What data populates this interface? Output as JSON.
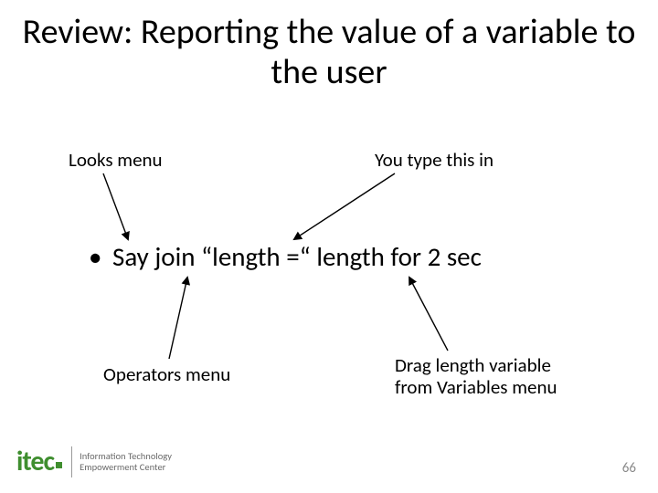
{
  "title": "Review: Reporting the value of a variable to the user",
  "labels": {
    "looks_menu": "Looks menu",
    "you_type": "You type this in",
    "operators_menu": "Operators menu",
    "drag_var": "Drag length variable from Variables menu"
  },
  "bullet": "Say join “length =“ length for 2 sec",
  "page_number": "66",
  "logo": {
    "mark": "itec",
    "line1": "Information Technology",
    "line2": "Empowerment Center"
  }
}
